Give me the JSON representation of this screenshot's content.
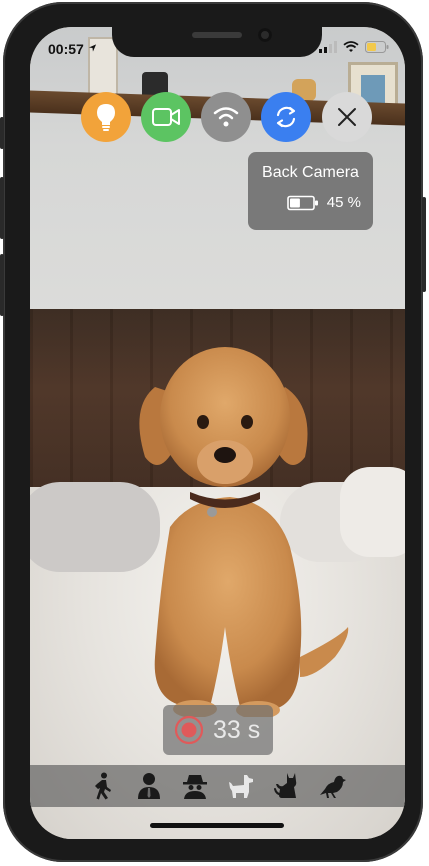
{
  "status_bar": {
    "time": "00:57"
  },
  "controls": [
    {
      "name": "light-toggle-button",
      "icon": "lightbulb-icon",
      "color": "#f2a33a"
    },
    {
      "name": "video-toggle-button",
      "icon": "video-camera-icon",
      "color": "#5cc462"
    },
    {
      "name": "wifi-button",
      "icon": "wifi-icon",
      "color": "#8f8f8f"
    },
    {
      "name": "switch-camera-button",
      "icon": "rotate-camera-icon",
      "color": "#3a7ff0"
    },
    {
      "name": "close-button",
      "icon": "close-icon",
      "color": "#d9d9d9"
    }
  ],
  "camera_info": {
    "label": "Back Camera",
    "battery": "45 %",
    "battery_level": 0.45
  },
  "recording": {
    "time": "33 s",
    "color": "#e05a5a"
  },
  "detection_filters": [
    {
      "name": "person-walking-icon"
    },
    {
      "name": "person-icon"
    },
    {
      "name": "spy-icon"
    },
    {
      "name": "dog-icon"
    },
    {
      "name": "cat-icon"
    },
    {
      "name": "bird-icon"
    }
  ]
}
